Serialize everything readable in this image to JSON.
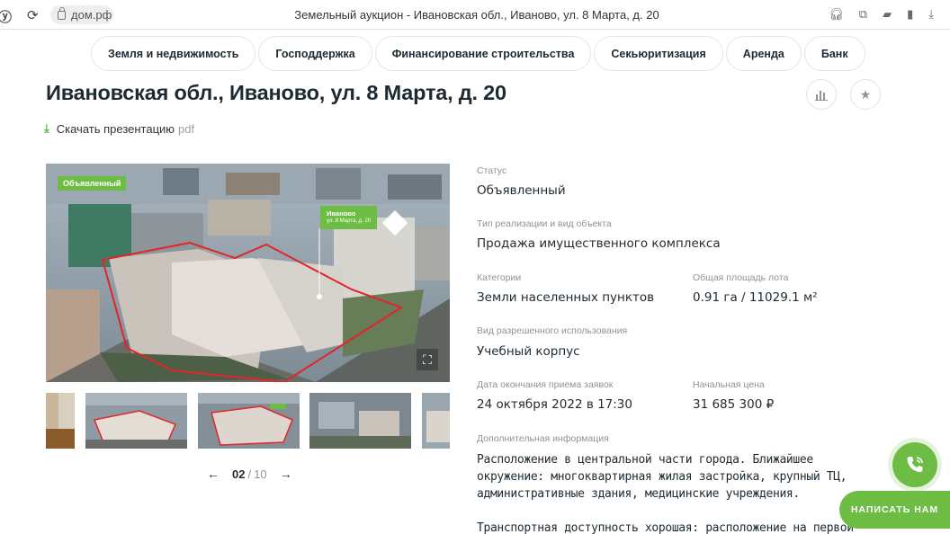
{
  "browser": {
    "domain": "дом.рф",
    "tab_title": "Земельный аукцион - Ивановская обл., Иваново, ул. 8 Марта, д. 20",
    "left_icons": [
      "yandex-icon",
      "reload-icon"
    ],
    "right_icons": [
      "headphones-icon",
      "extensions-icon",
      "comment-icon",
      "bookmark-icon",
      "download-icon"
    ]
  },
  "nav": {
    "items": [
      {
        "label": "Земля и недвижимость"
      },
      {
        "label": "Господдержка"
      },
      {
        "label": "Финансирование строительства"
      },
      {
        "label": "Секьюритизация"
      },
      {
        "label": "Аренда"
      },
      {
        "label": "Банк"
      }
    ]
  },
  "header": {
    "title": "Ивановская обл., Иваново, ул. 8 Марта, д. 20",
    "download_label": "Скачать презентацию",
    "download_ext": "pdf"
  },
  "gallery": {
    "status_tag": "Объявленный",
    "map_label_title": "Иваново",
    "map_label_subtitle": "ул. 8 Марта, д. 20",
    "current": "02",
    "separator": "/",
    "total": "10"
  },
  "details": {
    "status_label": "Статус",
    "status_value": "Объявленный",
    "type_label": "Тип реализации и вид объекта",
    "type_value": "Продажа имущественного комплекса",
    "category_label": "Категории",
    "category_value": "Земли населенных пунктов",
    "area_label": "Общая площадь лота",
    "area_value": "0.91 га / 11029.1 м²",
    "usage_label": "Вид разрешенного использования",
    "usage_value": "Учебный корпус",
    "deadline_label": "Дата окончания приема заявок",
    "deadline_value": "24 октября 2022 в 17:30",
    "price_label": "Начальная цена",
    "price_value": "31 685 300 ₽",
    "info_label": "Дополнительная информация",
    "info_paragraph_1": "Расположение в центральной части города.  Ближайшее окружение: многоквартирная жилая застройка, крупный ТЦ, административные здания, медицинские учреждения.",
    "info_paragraph_2": "Транспортная доступность хорошая: расположение на первой"
  },
  "floating": {
    "write_label": "НАПИСАТЬ НАМ"
  },
  "colors": {
    "accent": "#6dbd45",
    "text": "#1e2a32",
    "muted": "#8a949b",
    "border": "#e1e6ea"
  }
}
